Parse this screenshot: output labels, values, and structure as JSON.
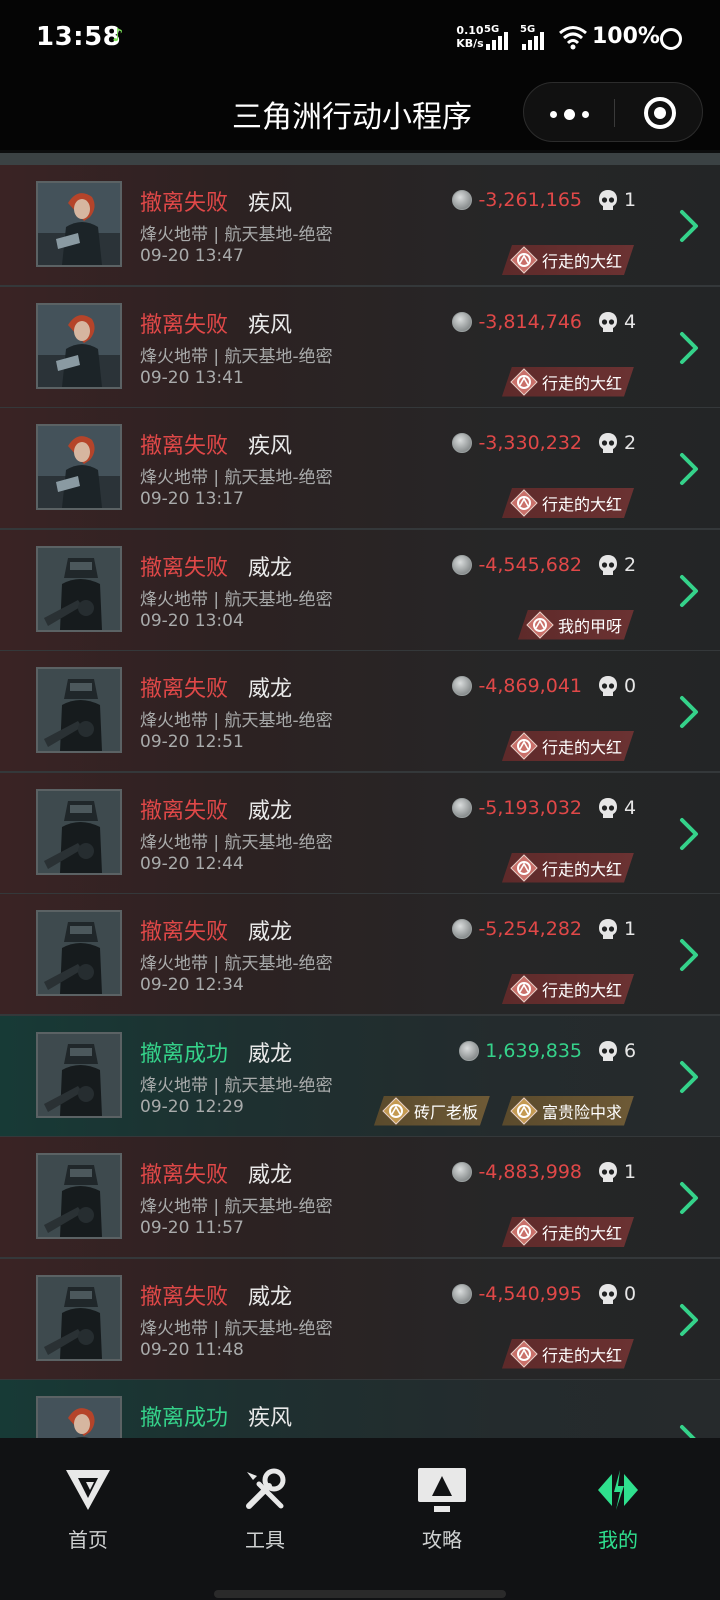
{
  "statusbar": {
    "time": "13:58",
    "speed_value": "0.10",
    "speed_unit": "KB/s",
    "sim1": "5G",
    "sim2": "5G",
    "battery": "100%"
  },
  "header": {
    "title": "三角洲行动小程序"
  },
  "records": [
    {
      "status": "撤离失败",
      "result": "fail",
      "operator": "疾风",
      "map": "烽火地带 | 航天基地-绝密",
      "time": "09-20 13:47",
      "value": "-3,261,165",
      "kills": "1",
      "badges": [
        {
          "label": "行走的大红",
          "style": "red"
        }
      ]
    },
    {
      "status": "撤离失败",
      "result": "fail",
      "operator": "疾风",
      "map": "烽火地带 | 航天基地-绝密",
      "time": "09-20 13:41",
      "value": "-3,814,746",
      "kills": "4",
      "badges": [
        {
          "label": "行走的大红",
          "style": "red"
        }
      ]
    },
    {
      "status": "撤离失败",
      "result": "fail",
      "operator": "疾风",
      "map": "烽火地带 | 航天基地-绝密",
      "time": "09-20 13:17",
      "value": "-3,330,232",
      "kills": "2",
      "badges": [
        {
          "label": "行走的大红",
          "style": "red"
        }
      ]
    },
    {
      "status": "撤离失败",
      "result": "fail",
      "operator": "威龙",
      "map": "烽火地带 | 航天基地-绝密",
      "time": "09-20 13:04",
      "value": "-4,545,682",
      "kills": "2",
      "badges": [
        {
          "label": "我的甲呀",
          "style": "red"
        }
      ]
    },
    {
      "status": "撤离失败",
      "result": "fail",
      "operator": "威龙",
      "map": "烽火地带 | 航天基地-绝密",
      "time": "09-20 12:51",
      "value": "-4,869,041",
      "kills": "0",
      "badges": [
        {
          "label": "行走的大红",
          "style": "red"
        }
      ]
    },
    {
      "status": "撤离失败",
      "result": "fail",
      "operator": "威龙",
      "map": "烽火地带 | 航天基地-绝密",
      "time": "09-20 12:44",
      "value": "-5,193,032",
      "kills": "4",
      "badges": [
        {
          "label": "行走的大红",
          "style": "red"
        }
      ]
    },
    {
      "status": "撤离失败",
      "result": "fail",
      "operator": "威龙",
      "map": "烽火地带 | 航天基地-绝密",
      "time": "09-20 12:34",
      "value": "-5,254,282",
      "kills": "1",
      "badges": [
        {
          "label": "行走的大红",
          "style": "red"
        }
      ]
    },
    {
      "status": "撤离成功",
      "result": "success",
      "operator": "威龙",
      "map": "烽火地带 | 航天基地-绝密",
      "time": "09-20 12:29",
      "value": "1,639,835",
      "kills": "6",
      "badges": [
        {
          "label": "砖厂老板",
          "style": "gold"
        },
        {
          "label": "富贵险中求",
          "style": "gold"
        }
      ]
    },
    {
      "status": "撤离失败",
      "result": "fail",
      "operator": "威龙",
      "map": "烽火地带 | 航天基地-绝密",
      "time": "09-20 11:57",
      "value": "-4,883,998",
      "kills": "1",
      "badges": [
        {
          "label": "行走的大红",
          "style": "red"
        }
      ]
    },
    {
      "status": "撤离失败",
      "result": "fail",
      "operator": "威龙",
      "map": "烽火地带 | 航天基地-绝密",
      "time": "09-20 11:48",
      "value": "-4,540,995",
      "kills": "0",
      "badges": [
        {
          "label": "行走的大红",
          "style": "red"
        }
      ]
    },
    {
      "status": "撤离成功",
      "result": "success",
      "operator": "疾风",
      "map": "",
      "time": "",
      "value": "",
      "kills": "",
      "badges": []
    }
  ],
  "nav": [
    {
      "label": "首页",
      "icon": "home-logo-icon",
      "active": false
    },
    {
      "label": "工具",
      "icon": "tools-icon",
      "active": false
    },
    {
      "label": "攻略",
      "icon": "guide-monitor-icon",
      "active": false
    },
    {
      "label": "我的",
      "icon": "profile-logo-icon",
      "active": true
    }
  ],
  "colors": {
    "fail": "#e04848",
    "success": "#35d28a",
    "active_nav": "#2fe08e"
  }
}
